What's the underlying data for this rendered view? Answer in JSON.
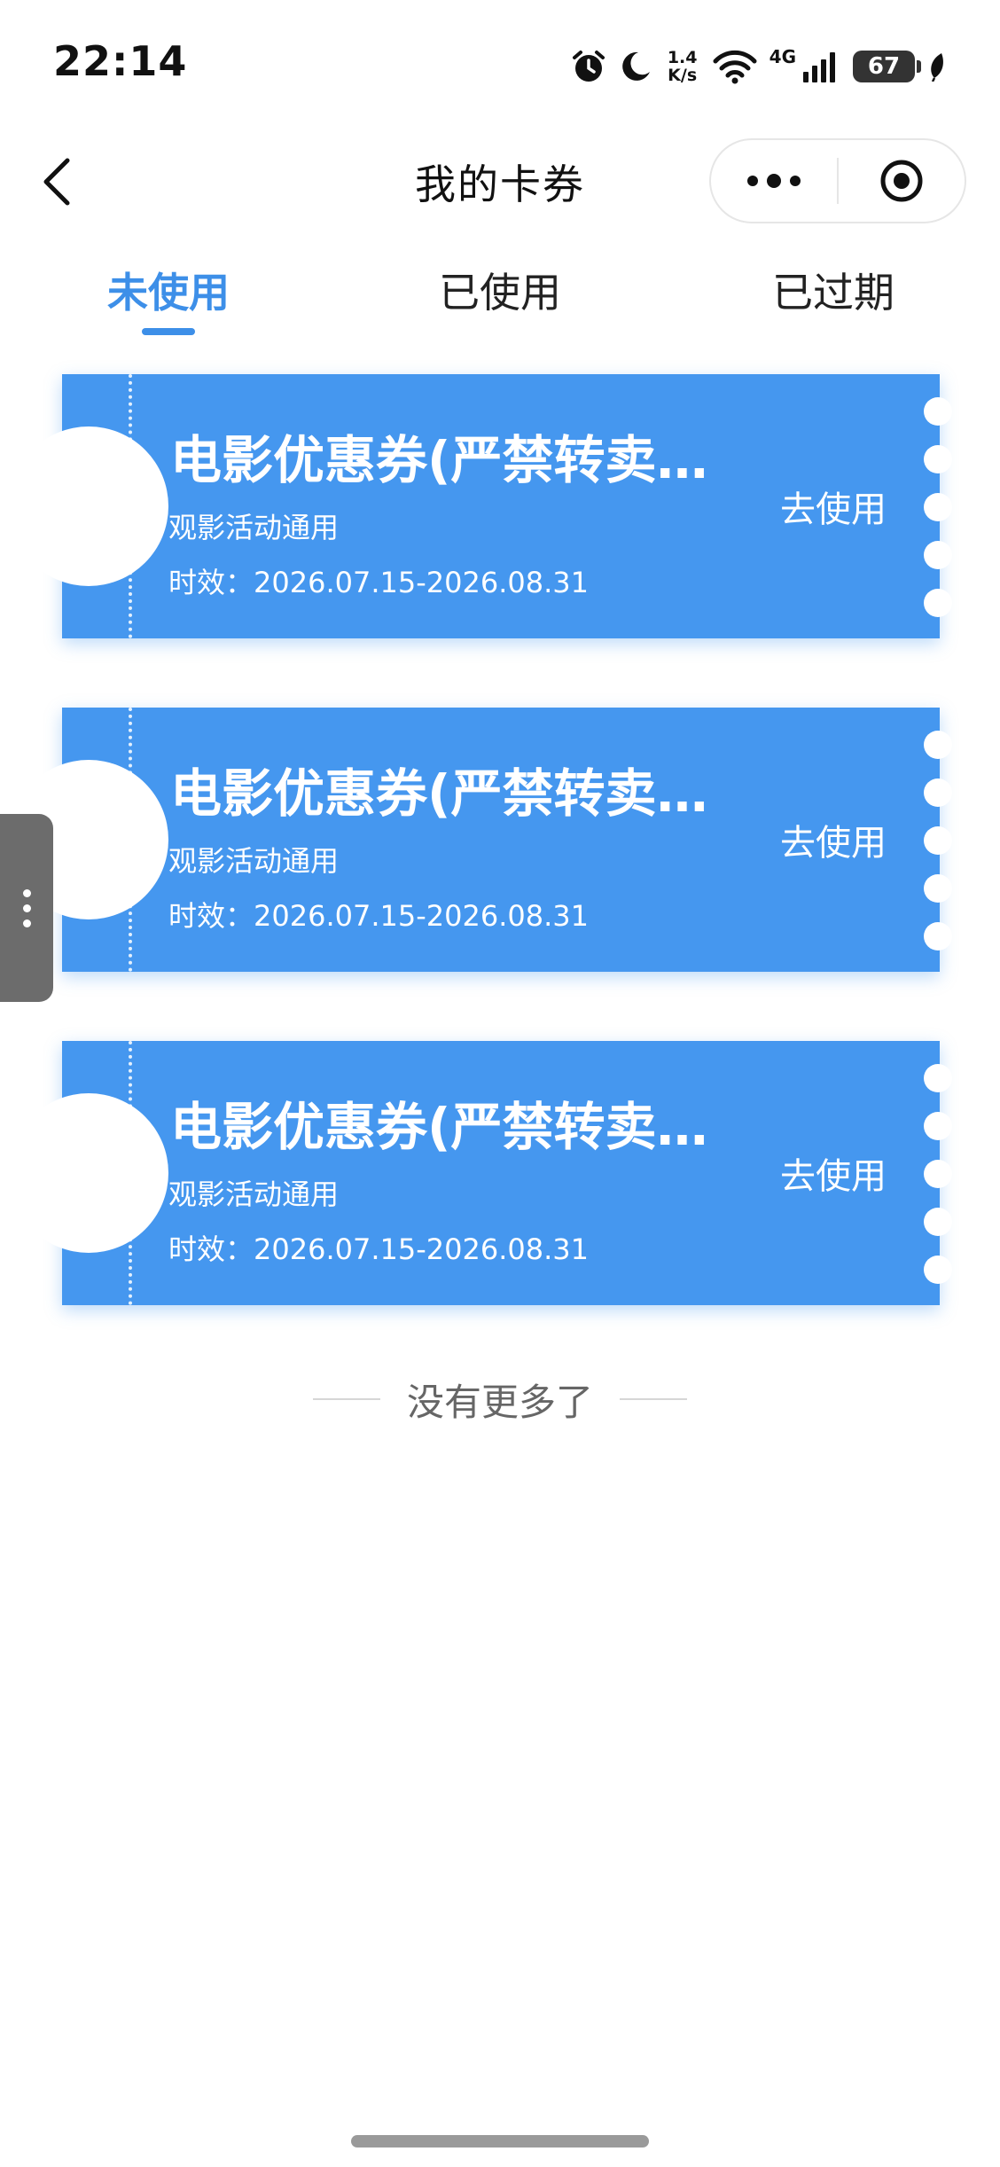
{
  "status_bar": {
    "time": "22:14",
    "net_speed_value": "1.4",
    "net_speed_unit": "K/s",
    "network_type": "4G",
    "battery": "67",
    "icons": [
      "alarm-icon",
      "moon-icon",
      "wifi-icon",
      "signal-icon",
      "battery-icon",
      "leaf-icon"
    ]
  },
  "header": {
    "title": "我的卡券",
    "back_icon": "chevron-left-icon",
    "more_icon": "more-dots-icon",
    "close_icon": "target-icon"
  },
  "tabs": [
    {
      "label": "未使用",
      "active": true
    },
    {
      "label": "已使用",
      "active": false
    },
    {
      "label": "已过期",
      "active": false
    }
  ],
  "coupons": [
    {
      "title": "电影优惠券(严禁转卖...",
      "scope": "观影活动通用",
      "validity": "时效：2026.07.15-2026.08.31",
      "action": "去使用"
    },
    {
      "title": "电影优惠券(严禁转卖...",
      "scope": "观影活动通用",
      "validity": "时效：2026.07.15-2026.08.31",
      "action": "去使用"
    },
    {
      "title": "电影优惠券(严禁转卖...",
      "scope": "观影活动通用",
      "validity": "时效：2026.07.15-2026.08.31",
      "action": "去使用"
    }
  ],
  "end_text": "没有更多了",
  "colors": {
    "accent": "#3d8fe8",
    "coupon_bg": "#4597ef",
    "text_primary": "#222222",
    "text_muted": "#666666"
  }
}
